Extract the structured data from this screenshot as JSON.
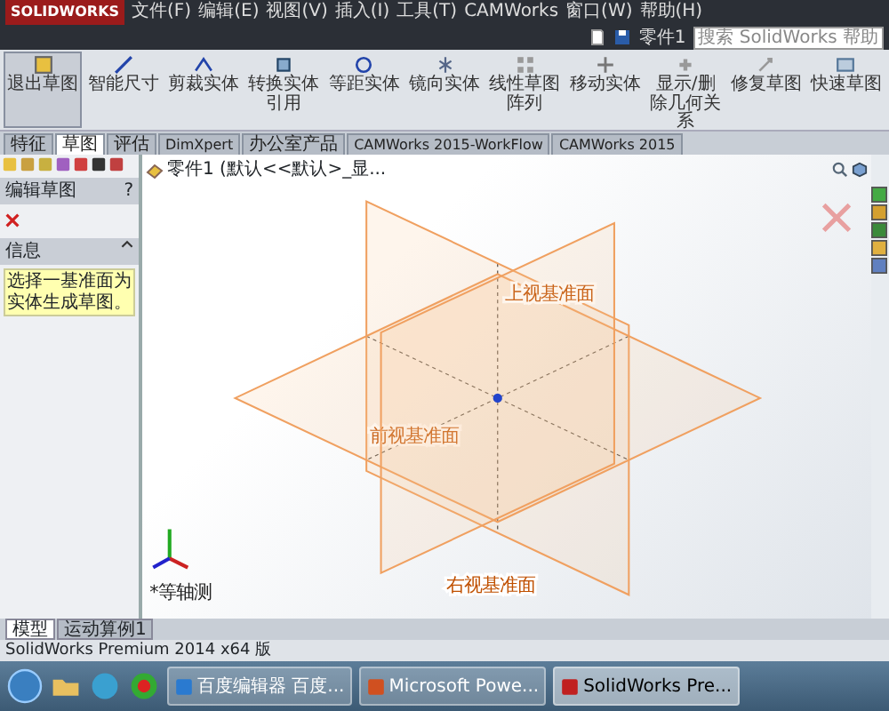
{
  "app": {
    "logo": "SOLIDWORKS",
    "menus": [
      "文件(F)",
      "编辑(E)",
      "视图(V)",
      "插入(I)",
      "工具(T)",
      "CAMWorks",
      "窗口(W)",
      "帮助(H)"
    ],
    "document": "零件1",
    "search": {
      "placeholder": "搜索 SolidWorks 帮助"
    }
  },
  "ribbon": [
    {
      "label": "退出草图",
      "selected": true
    },
    {
      "label": "智能尺寸",
      "selected": false
    },
    {
      "label": "剪裁实体",
      "selected": false
    },
    {
      "label": "转换实体引用",
      "selected": false
    },
    {
      "label": "等距实体",
      "selected": false
    },
    {
      "label": "镜向实体",
      "selected": false
    },
    {
      "label": "线性草图阵列",
      "selected": false
    },
    {
      "label": "移动实体",
      "selected": false
    },
    {
      "label": "显示/删除几何关系",
      "selected": false
    },
    {
      "label": "修复草图",
      "selected": false
    },
    {
      "label": "快速草图",
      "selected": false
    }
  ],
  "command_tabs": [
    {
      "label": "特征",
      "selected": false
    },
    {
      "label": "草图",
      "selected": true
    },
    {
      "label": "评估",
      "selected": false
    },
    {
      "label": "DimXpert",
      "selected": false
    },
    {
      "label": "办公室产品",
      "selected": false
    },
    {
      "label": "CAMWorks 2015-WorkFlow",
      "selected": false
    },
    {
      "label": "CAMWorks 2015",
      "selected": false
    }
  ],
  "panel": {
    "title": "编辑草图",
    "help": "?",
    "info_heading": "信息",
    "message": "选择一基准面为实体生成草图。"
  },
  "tree": {
    "root": "零件1 (默认<<默认>_显..."
  },
  "viewport": {
    "planes": [
      {
        "label": "前视基准面"
      },
      {
        "label": "上视基准面"
      },
      {
        "label": "右视基准面"
      }
    ],
    "view_label": "*等轴测"
  },
  "bottom_tabs": [
    {
      "label": "模型",
      "selected": true
    },
    {
      "label": "运动算例1",
      "selected": false
    }
  ],
  "status_bar": "SolidWorks Premium 2014 x64 版",
  "taskbar": [
    {
      "label": "百度编辑器 百度...",
      "selected": false
    },
    {
      "label": "Microsoft Powe...",
      "selected": false
    },
    {
      "label": "SolidWorks Pre...",
      "selected": true
    }
  ]
}
